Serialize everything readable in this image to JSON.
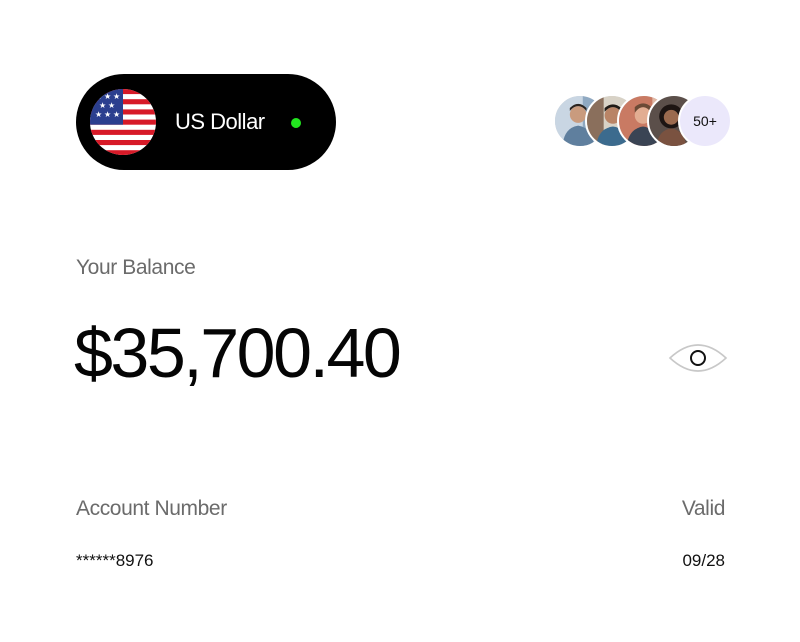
{
  "currency": {
    "label": "US Dollar",
    "flag_icon": "us-flag-icon",
    "status_color": "#22e51f"
  },
  "members": {
    "avatars": [
      "avatar-1",
      "avatar-2",
      "avatar-3",
      "avatar-4"
    ],
    "more_label": "50+"
  },
  "balance": {
    "label": "Your Balance",
    "amount": "$35,700.40",
    "visibility_icon": "eye-icon"
  },
  "account": {
    "number_label": "Account Number",
    "number_value": "******8976",
    "valid_label": "Valid",
    "valid_value": "09/28"
  }
}
